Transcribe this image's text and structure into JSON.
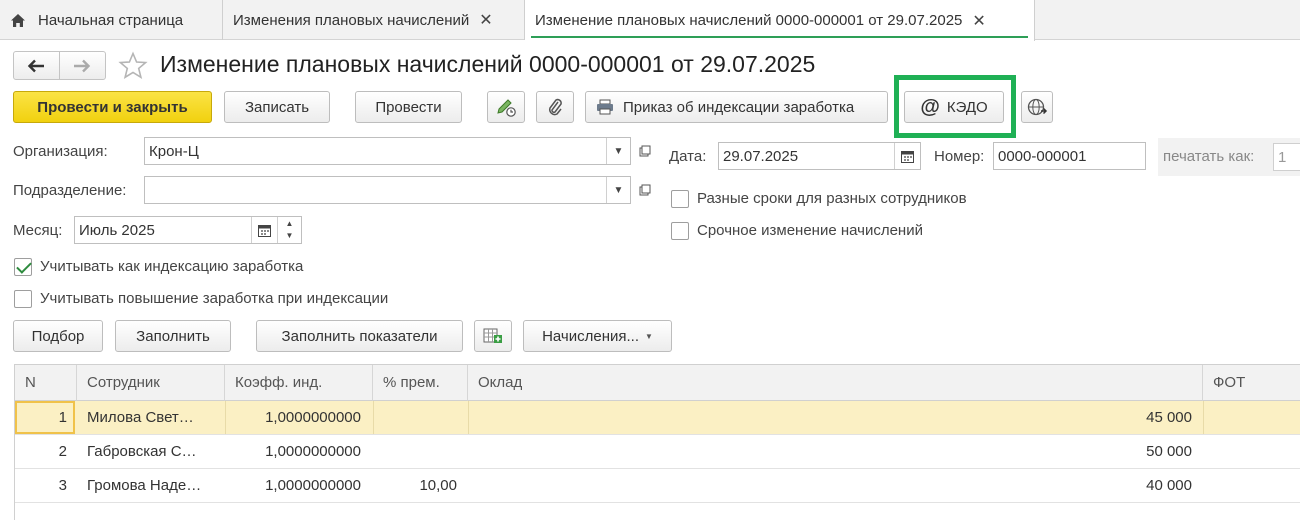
{
  "tabs": {
    "home": "Начальная страница",
    "list": "Изменения плановых начислений",
    "doc": "Изменение плановых начислений 0000-000001 от 29.07.2025"
  },
  "page_title": "Изменение плановых начислений 0000-000001 от 29.07.2025",
  "toolbar": {
    "post_close": "Провести и закрыть",
    "save": "Записать",
    "post": "Провести",
    "print_order": "Приказ об индексации заработка",
    "kedo": "КЭДО"
  },
  "form": {
    "org_label": "Организация:",
    "org_value": "Крон-Ц",
    "dept_label": "Подразделение:",
    "dept_value": "",
    "month_label": "Месяц:",
    "month_value": "Июль 2025",
    "date_label": "Дата:",
    "date_value": "29.07.2025",
    "number_label": "Номер:",
    "number_value": "0000-000001",
    "print_as_label": "печатать как:",
    "print_as_value": "1"
  },
  "checkboxes": {
    "different_dates": "Разные сроки для разных сотрудников",
    "urgent_change": "Срочное изменение начислений",
    "indexation": "Учитывать как индексацию заработка",
    "raise_on_indexation": "Учитывать повышение заработка при индексации"
  },
  "table_toolbar": {
    "pick": "Подбор",
    "fill": "Заполнить",
    "fill_indicators": "Заполнить показатели",
    "accruals": "Начисления..."
  },
  "table": {
    "columns": [
      "N",
      "Сотрудник",
      "Коэфф. инд.",
      "% прем.",
      "Оклад",
      "ФОТ"
    ],
    "rows": [
      {
        "n": "1",
        "employee": "Милова Свет…",
        "coef": "1,0000000000",
        "bonus": "",
        "salary": "45 000"
      },
      {
        "n": "2",
        "employee": "Габровская С…",
        "coef": "1,0000000000",
        "bonus": "",
        "salary": "50 000"
      },
      {
        "n": "3",
        "employee": "Громова Наде…",
        "coef": "1,0000000000",
        "bonus": "10,00",
        "salary": "40 000"
      }
    ]
  },
  "colors": {
    "accent_green": "#2e9f57",
    "highlight_green": "#1fb055",
    "primary_yellow": "#f5d624",
    "selected_row": "#fbf0c4"
  }
}
